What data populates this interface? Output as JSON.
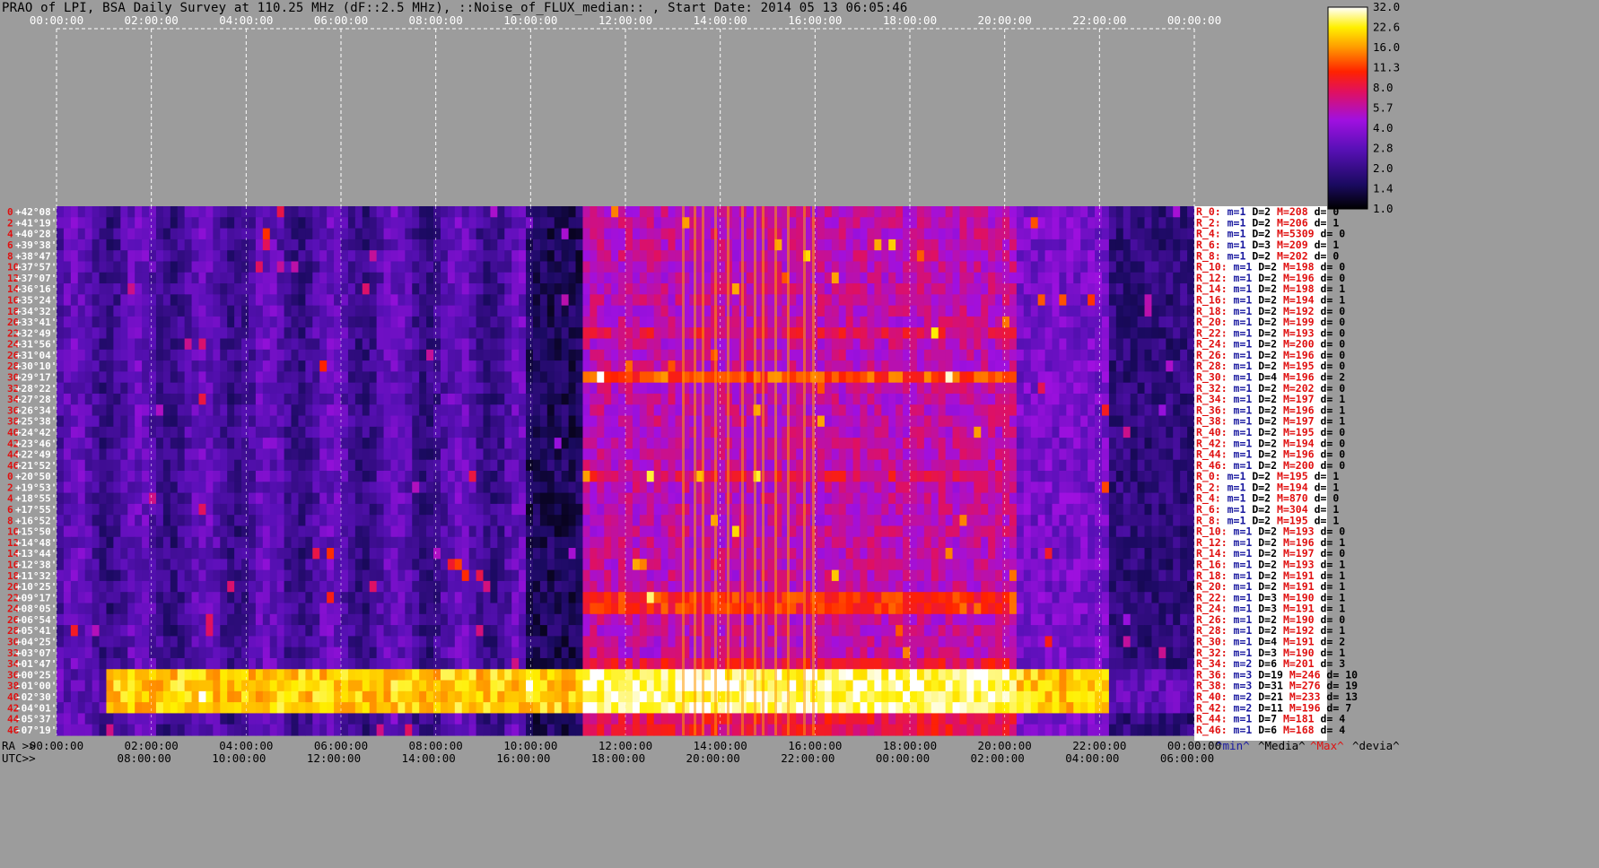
{
  "title": "PRAO of LPI, BSA Daily Survey at 110.25 MHz (dF::2.5 MHz), ::Noise_of_FLUX_median:: , Start Date: 2014 05 13 06:05:46",
  "colors": {
    "background": "#9c9c9c",
    "colormap": [
      "#000000",
      "#1a0a60",
      "#5a10b8",
      "#a010e0",
      "#e01060",
      "#ff2200",
      "#ff9a00",
      "#fff000",
      "#ffffff"
    ]
  },
  "bottom_axis": {
    "ra_prefix": "RA >>",
    "utc_prefix": "UTC>>",
    "ra_ticks": [
      "00:00:00",
      "02:00:00",
      "04:00:00",
      "06:00:00",
      "08:00:00",
      "10:00:00",
      "12:00:00",
      "14:00:00",
      "16:00:00",
      "18:00:00",
      "20:00:00",
      "22:00:00",
      "00:00:00"
    ],
    "utc_ticks": [
      "08:00:00",
      "10:00:00",
      "12:00:00",
      "14:00:00",
      "16:00:00",
      "18:00:00",
      "20:00:00",
      "22:00:00",
      "00:00:00",
      "02:00:00",
      "04:00:00",
      "06:00:00"
    ]
  },
  "stats_footer": {
    "min": "^min^",
    "median": "^Media^",
    "max": "^Max^",
    "dev": "^devia^"
  },
  "chart_data": {
    "type": "heatmap",
    "title": "PRAO of LPI, BSA Daily Survey at 110.25 MHz (dF::2.5 MHz), ::Noise_of_FLUX_median:: , Start Date: 2014 05 13 06:05:46",
    "x_ticks_top": [
      "00:00:00",
      "02:00:00",
      "04:00:00",
      "06:00:00",
      "08:00:00",
      "10:00:00",
      "12:00:00",
      "14:00:00",
      "16:00:00",
      "18:00:00",
      "20:00:00",
      "22:00:00",
      "00:00:00"
    ],
    "y_declinations": [
      "+42°08'",
      "+41°19'",
      "+40°28'",
      "+39°38'",
      "+38°47'",
      "+37°57'",
      "+37°07'",
      "+36°16'",
      "+35°24'",
      "+34°32'",
      "+33°41'",
      "+32°49'",
      "+31°56'",
      "+31°04'",
      "+30°10'",
      "+29°17'",
      "+28°22'",
      "+27°28'",
      "+26°34'",
      "+25°38'",
      "+24°42'",
      "+23°46'",
      "+22°49'",
      "+21°52'",
      "+20°50'",
      "+19°53'",
      "+18°55'",
      "+17°55'",
      "+16°52'",
      "+15°50'",
      "+14°48'",
      "+13°44'",
      "+12°38'",
      "+11°32'",
      "+10°25'",
      "+09°17'",
      "+08°05'",
      "+06°54'",
      "+05°41'",
      "+04°25'",
      "+03°07'",
      "+01°47'",
      "+00°25'",
      "-01°00'",
      "-02°30'",
      "-04°01'",
      "-05°37'",
      "-07°19'"
    ],
    "y_beam_index": [
      0,
      2,
      4,
      6,
      8,
      10,
      12,
      14,
      16,
      18,
      20,
      22,
      24,
      26,
      28,
      30,
      32,
      34,
      36,
      38,
      40,
      42,
      44,
      46,
      0,
      2,
      4,
      6,
      8,
      10,
      12,
      14,
      16,
      18,
      20,
      22,
      24,
      26,
      28,
      30,
      32,
      34,
      36,
      38,
      40,
      42,
      44,
      46
    ],
    "colorbar": {
      "ticks": [
        "32.0",
        "22.6",
        "16.0",
        "11.3",
        "8.0",
        "5.7",
        "4.0",
        "2.8",
        "2.0",
        "1.4",
        "1.0"
      ],
      "scale": "log"
    },
    "row_stats": [
      {
        "r": "R_0:",
        "m": "m=1",
        "d": "D=2",
        "M": "M=208",
        "dev": "d= 0"
      },
      {
        "r": "R_2:",
        "m": "m=1",
        "d": "D=2",
        "M": "M=206",
        "dev": "d= 1"
      },
      {
        "r": "R_4:",
        "m": "m=1",
        "d": "D=2",
        "M": "M=5309",
        "dev": "d= 0"
      },
      {
        "r": "R_6:",
        "m": "m=1",
        "d": "D=3",
        "M": "M=209",
        "dev": "d= 1"
      },
      {
        "r": "R_8:",
        "m": "m=1",
        "d": "D=2",
        "M": "M=202",
        "dev": "d= 0"
      },
      {
        "r": "R_10:",
        "m": "m=1",
        "d": "D=2",
        "M": "M=198",
        "dev": "d= 0"
      },
      {
        "r": "R_12:",
        "m": "m=1",
        "d": "D=2",
        "M": "M=196",
        "dev": "d= 0"
      },
      {
        "r": "R_14:",
        "m": "m=1",
        "d": "D=2",
        "M": "M=198",
        "dev": "d= 1"
      },
      {
        "r": "R_16:",
        "m": "m=1",
        "d": "D=2",
        "M": "M=194",
        "dev": "d= 1"
      },
      {
        "r": "R_18:",
        "m": "m=1",
        "d": "D=2",
        "M": "M=192",
        "dev": "d= 0"
      },
      {
        "r": "R_20:",
        "m": "m=1",
        "d": "D=2",
        "M": "M=199",
        "dev": "d= 0"
      },
      {
        "r": "R_22:",
        "m": "m=1",
        "d": "D=2",
        "M": "M=193",
        "dev": "d= 0"
      },
      {
        "r": "R_24:",
        "m": "m=1",
        "d": "D=2",
        "M": "M=200",
        "dev": "d= 0"
      },
      {
        "r": "R_26:",
        "m": "m=1",
        "d": "D=2",
        "M": "M=196",
        "dev": "d= 0"
      },
      {
        "r": "R_28:",
        "m": "m=1",
        "d": "D=2",
        "M": "M=195",
        "dev": "d= 0"
      },
      {
        "r": "R_30:",
        "m": "m=1",
        "d": "D=4",
        "M": "M=196",
        "dev": "d= 2"
      },
      {
        "r": "R_32:",
        "m": "m=1",
        "d": "D=2",
        "M": "M=202",
        "dev": "d= 0"
      },
      {
        "r": "R_34:",
        "m": "m=1",
        "d": "D=2",
        "M": "M=197",
        "dev": "d= 1"
      },
      {
        "r": "R_36:",
        "m": "m=1",
        "d": "D=2",
        "M": "M=196",
        "dev": "d= 1"
      },
      {
        "r": "R_38:",
        "m": "m=1",
        "d": "D=2",
        "M": "M=197",
        "dev": "d= 1"
      },
      {
        "r": "R_40:",
        "m": "m=1",
        "d": "D=2",
        "M": "M=195",
        "dev": "d= 0"
      },
      {
        "r": "R_42:",
        "m": "m=1",
        "d": "D=2",
        "M": "M=194",
        "dev": "d= 0"
      },
      {
        "r": "R_44:",
        "m": "m=1",
        "d": "D=2",
        "M": "M=196",
        "dev": "d= 0"
      },
      {
        "r": "R_46:",
        "m": "m=1",
        "d": "D=2",
        "M": "M=200",
        "dev": "d= 0"
      },
      {
        "r": "R_0:",
        "m": "m=1",
        "d": "D=2",
        "M": "M=195",
        "dev": "d= 1"
      },
      {
        "r": "R_2:",
        "m": "m=1",
        "d": "D=2",
        "M": "M=194",
        "dev": "d= 1"
      },
      {
        "r": "R_4:",
        "m": "m=1",
        "d": "D=2",
        "M": "M=870",
        "dev": "d= 0"
      },
      {
        "r": "R_6:",
        "m": "m=1",
        "d": "D=2",
        "M": "M=304",
        "dev": "d= 1"
      },
      {
        "r": "R_8:",
        "m": "m=1",
        "d": "D=2",
        "M": "M=195",
        "dev": "d= 1"
      },
      {
        "r": "R_10:",
        "m": "m=1",
        "d": "D=2",
        "M": "M=193",
        "dev": "d= 0"
      },
      {
        "r": "R_12:",
        "m": "m=1",
        "d": "D=2",
        "M": "M=196",
        "dev": "d= 1"
      },
      {
        "r": "R_14:",
        "m": "m=1",
        "d": "D=2",
        "M": "M=197",
        "dev": "d= 0"
      },
      {
        "r": "R_16:",
        "m": "m=1",
        "d": "D=2",
        "M": "M=193",
        "dev": "d= 1"
      },
      {
        "r": "R_18:",
        "m": "m=1",
        "d": "D=2",
        "M": "M=191",
        "dev": "d= 1"
      },
      {
        "r": "R_20:",
        "m": "m=1",
        "d": "D=2",
        "M": "M=191",
        "dev": "d= 1"
      },
      {
        "r": "R_22:",
        "m": "m=1",
        "d": "D=3",
        "M": "M=190",
        "dev": "d= 1"
      },
      {
        "r": "R_24:",
        "m": "m=1",
        "d": "D=3",
        "M": "M=191",
        "dev": "d= 1"
      },
      {
        "r": "R_26:",
        "m": "m=1",
        "d": "D=2",
        "M": "M=190",
        "dev": "d= 0"
      },
      {
        "r": "R_28:",
        "m": "m=1",
        "d": "D=2",
        "M": "M=192",
        "dev": "d= 1"
      },
      {
        "r": "R_30:",
        "m": "m=1",
        "d": "D=4",
        "M": "M=191",
        "dev": "d= 2"
      },
      {
        "r": "R_32:",
        "m": "m=1",
        "d": "D=3",
        "M": "M=190",
        "dev": "d= 1"
      },
      {
        "r": "R_34:",
        "m": "m=2",
        "d": "D=6",
        "M": "M=201",
        "dev": "d= 3"
      },
      {
        "r": "R_36:",
        "m": "m=3",
        "d": "D=19",
        "M": "M=246",
        "dev": "d= 10"
      },
      {
        "r": "R_38:",
        "m": "m=3",
        "d": "D=31",
        "M": "M=276",
        "dev": "d= 19"
      },
      {
        "r": "R_40:",
        "m": "m=2",
        "d": "D=21",
        "M": "M=233",
        "dev": "d= 13"
      },
      {
        "r": "R_42:",
        "m": "m=2",
        "d": "D=11",
        "M": "M=196",
        "dev": "d= 7"
      },
      {
        "r": "R_44:",
        "m": "m=1",
        "d": "D=7",
        "M": "M=181",
        "dev": "d= 4"
      },
      {
        "r": "R_46:",
        "m": "m=1",
        "d": "D=6",
        "M": "M=168",
        "dev": "d= 4"
      }
    ]
  }
}
